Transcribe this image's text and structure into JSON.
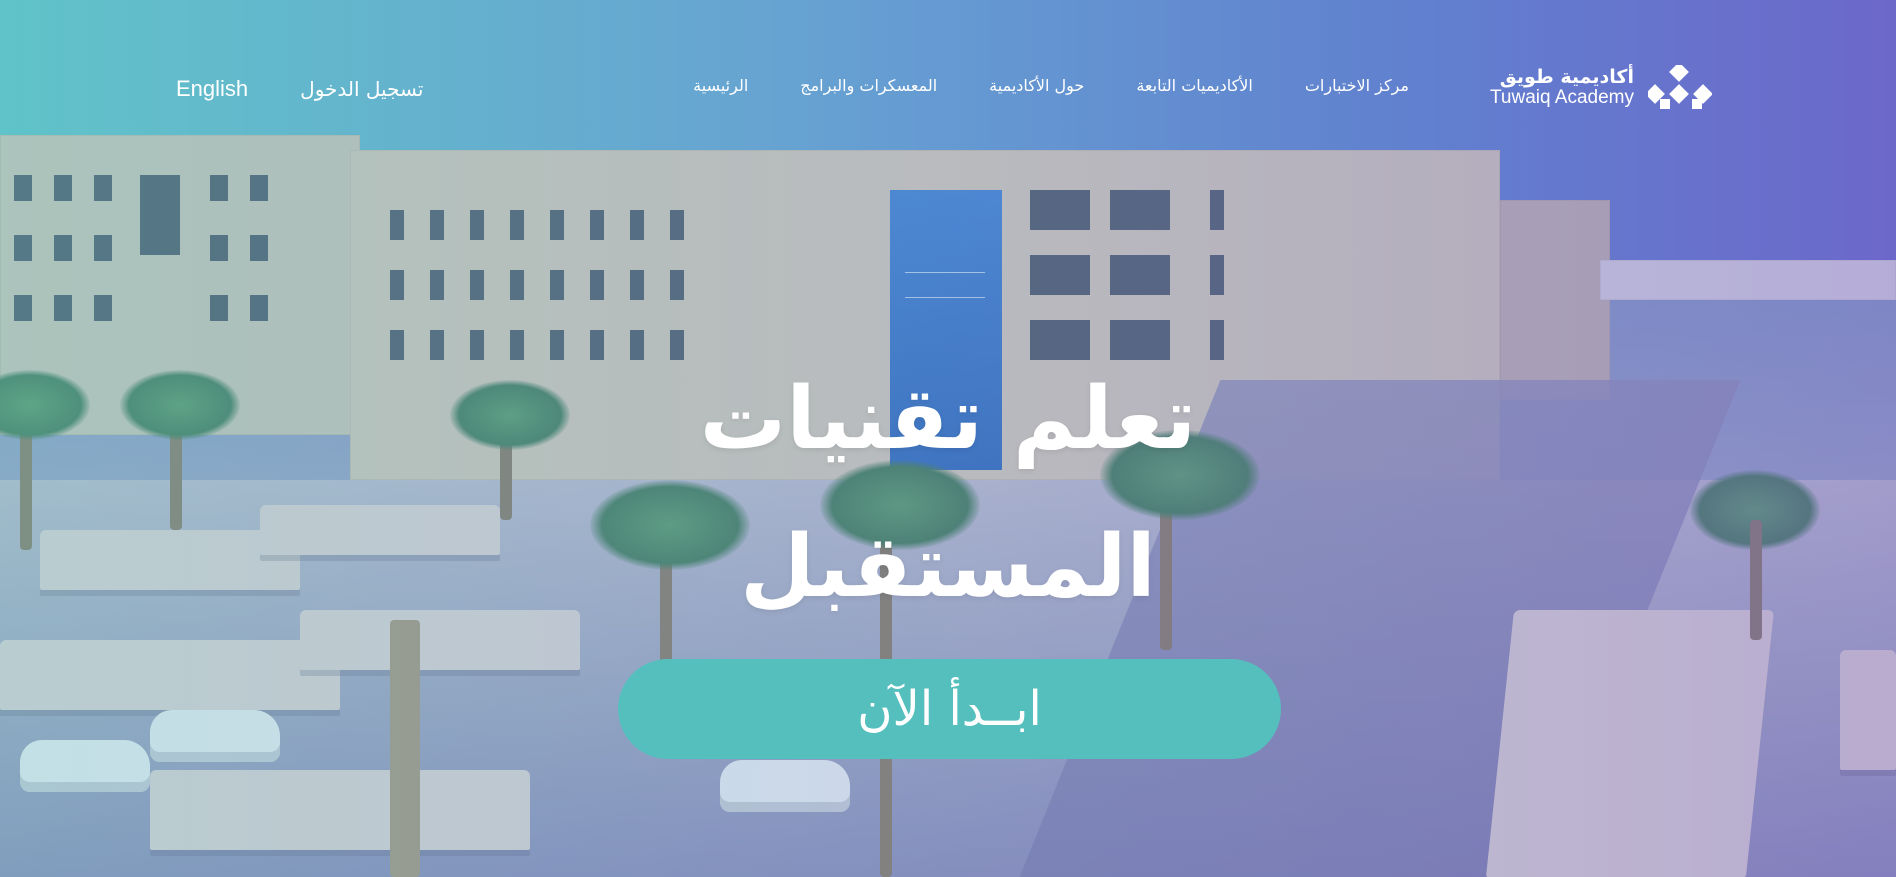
{
  "brand": {
    "name_ar": "أكاديمية طويق",
    "name_en": "Tuwaiq Academy"
  },
  "nav": {
    "items": [
      {
        "label": "الرئيسية"
      },
      {
        "label": "المعسكرات والبرامج"
      },
      {
        "label": "حول الأكاديمية"
      },
      {
        "label": "الأكاديميات التابعة"
      },
      {
        "label": "مركز الاختبارات"
      }
    ],
    "login_label": "تسجيل الدخول",
    "language_label": "English"
  },
  "hero": {
    "headline_line1": "تعلم تقنيات",
    "headline_line2": "المستقبل",
    "cta_label": "ابــدأ الآن",
    "background_image": "aerial-campus-photo"
  },
  "colors": {
    "cta": "#55bfbd",
    "text": "#ffffff",
    "overlay_left": "#63c1c9",
    "overlay_right": "#6b6ecb"
  }
}
